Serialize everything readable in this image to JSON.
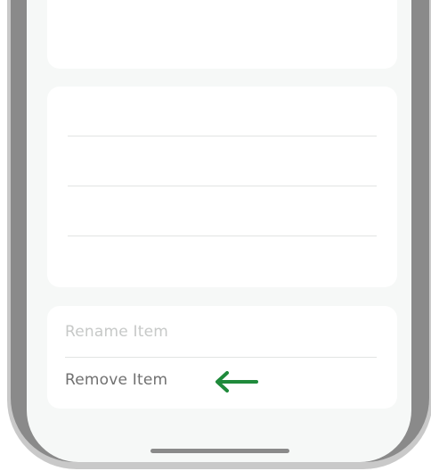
{
  "menu": {
    "items": [
      {
        "label": "Rename Item",
        "state": "disabled"
      },
      {
        "label": "Remove Item",
        "state": "enabled"
      }
    ]
  },
  "annotation": {
    "icon": "arrow-left-icon",
    "color": "#1f8a3b"
  },
  "colors": {
    "screen_background": "#f6f8f7",
    "card_background": "#ffffff",
    "disabled_text": "#c7c9c8",
    "enabled_text": "#707070"
  }
}
